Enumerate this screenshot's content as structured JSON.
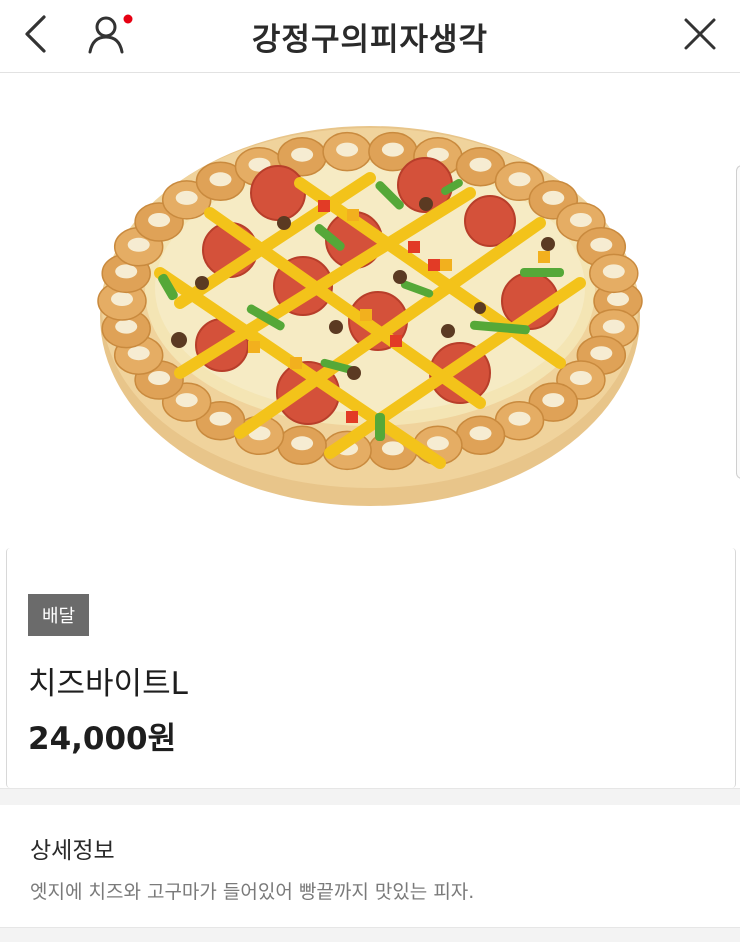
{
  "header": {
    "title": "강정구의피자생각",
    "back_icon": "chevron-left-icon",
    "user_icon": "user-icon",
    "notification_color": "#e60012",
    "close_icon": "close-icon"
  },
  "product": {
    "image_icon": "pizza-image",
    "badge": "배달",
    "name": "치즈바이트L",
    "price": "24,000원"
  },
  "detail": {
    "title": "상세정보",
    "description": "엣지에 치즈와 고구마가 들어있어 빵끝까지 맛있는 피자."
  }
}
